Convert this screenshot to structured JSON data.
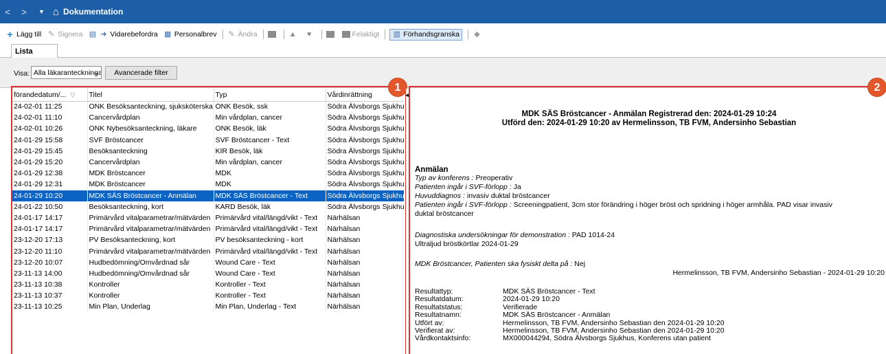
{
  "titlebar": {
    "title": "Dokumentation",
    "back": "<",
    "forward": ">"
  },
  "toolbar": {
    "add": "Lägg till",
    "sign": "Signera",
    "forward": "Vidarebefordra",
    "personal_letter": "Personalbrev",
    "edit": "Ändra",
    "wrong": "Felaktigt",
    "preview": "Förhandsgranska"
  },
  "tabs": {
    "list": "Lista"
  },
  "filter": {
    "show_label": "Visa:",
    "show_value": "Alla läkaranteckningar",
    "advanced_button": "Avancerade filter"
  },
  "list": {
    "columns": [
      "förandedatum/...",
      "Titel",
      "Typ",
      "Vårdinrättning"
    ],
    "rows": [
      [
        "24-02-01 11:25",
        "ONK Besöksanteckning, sjuksköterska",
        "ONK Besök, ssk",
        "Södra Älvsborgs Sjukhus"
      ],
      [
        "24-02-01 11:10",
        "Cancervårdplan",
        "Min vårdplan, cancer",
        "Södra Älvsborgs Sjukhus"
      ],
      [
        "24-02-01 10:26",
        "ONK Nybesöksanteckning, läkare",
        "ONK Besök, läk",
        "Södra Älvsborgs Sjukhus"
      ],
      [
        "24-01-29 15:58",
        "SVF Bröstcancer",
        "SVF Bröstcancer - Text",
        "Södra Älvsborgs Sjukhus"
      ],
      [
        "24-01-29 15:45",
        "Besöksanteckning",
        "KIR Besök, läk",
        "Södra Älvsborgs Sjukhus"
      ],
      [
        "24-01-29 15:20",
        "Cancervårdplan",
        "Min vårdplan, cancer",
        "Södra Älvsborgs Sjukhus"
      ],
      [
        "24-01-29 12:38",
        "MDK Bröstcancer",
        "MDK",
        "Södra Älvsborgs Sjukhus"
      ],
      [
        "24-01-29 12:31",
        "MDK Bröstcancer",
        "MDK",
        "Södra Älvsborgs Sjukhus"
      ],
      [
        "24-01-29 10:20",
        "MDK SÄS Bröstcancer - Anmälan",
        "MDK SÄS Bröstcancer - Text",
        "Södra Älvsborgs Sjukhus"
      ],
      [
        "24-01-22 10:50",
        "Besöksanteckning, kort",
        "KARD Besök, läk",
        "Södra Älvsborgs Sjukhus"
      ],
      [
        "24-01-17 14:17",
        "Primärvård vitalparametrar/mätvärden",
        "Primärvård vital/längd/vikt - Text",
        "Närhälsan"
      ],
      [
        "24-01-17 14:17",
        "Primärvård vitalparametrar/mätvärden",
        "Primärvård vital/längd/vikt - Text",
        "Närhälsan"
      ],
      [
        "23-12-20 17:13",
        "PV Besöksanteckning, kort",
        "PV besöksanteckning - kort",
        "Närhälsan"
      ],
      [
        "23-12-20 11:10",
        "Primärvård vitalparametrar/mätvärden",
        "Primärvård vital/längd/vikt - Text",
        "Närhälsan"
      ],
      [
        "23-12-20 10:07",
        "Hudbedömning/Omvårdnad sår",
        "Wound Care - Text",
        "Närhälsan"
      ],
      [
        "23-11-13 14:00",
        "Hudbedömning/Omvårdnad sår",
        "Wound Care - Text",
        "Närhälsan"
      ],
      [
        "23-11-13 10:38",
        "Kontroller",
        "Kontroller - Text",
        "Närhälsan"
      ],
      [
        "23-11-13 10:37",
        "Kontroller",
        "Kontroller - Text",
        "Närhälsan"
      ],
      [
        "23-11-13 10:25",
        "Min Plan, Underlag",
        "Min Plan, Underlag - Text",
        "Närhälsan"
      ]
    ],
    "selected_index": 8
  },
  "badges": {
    "one": "1",
    "two": "2"
  },
  "document": {
    "header1": "MDK SÄS Bröstcancer - Anmälan Registrerad den:  2024-01-29 10:24",
    "header2": "Utförd den:  2024-01-29 10:20  av Hermelinsson, TB FVM, Andersinho Sebastian",
    "section": "Anmälan",
    "conf_label": "Typ av konferens :",
    "conf_value": " Preoperativ",
    "svf1_label": "Patienten ingår i SVF-förlopp :",
    "svf1_value": " Ja",
    "diag_label": "Huvuddiagnos :",
    "diag_value": " invasiv duktal bröstcancer",
    "svf2_label": "Patienten ingår i SVF-förlopp :",
    "svf2_value": " Screeningpatient, 3cm stor förändring i höger bröst och spridning i höger armhåla. PAD visar invasiv",
    "svf2_cont": "duktal bröstcancer",
    "exam_label": "Diagnostiska undersökningar för demonstration :",
    "exam_value": " PAD 1014-24",
    "ultra": "Ultraljud bröstkörtlar 2024-01-29",
    "mdk_label": "MDK Bröstcancer, Patienten ska fysiskt delta på :",
    "mdk_value": " Nej",
    "signature": "Hermelinsson, TB FVM, Andersinho Sebastian - 2024-01-29 10:20",
    "results": [
      {
        "k": "Resultattyp:",
        "v": "MDK SÄS Bröstcancer - Text"
      },
      {
        "k": "Resultatdatum:",
        "v": "2024-01-29 10:20"
      },
      {
        "k": "Resultatstatus:",
        "v": "Verifierade"
      },
      {
        "k": "Resultatnamn:",
        "v": "MDK SÄS Bröstcancer - Anmälan"
      },
      {
        "k": "Utfört av:",
        "v": "Hermelinsson, TB FVM, Andersinho Sebastian den 2024-01-29 10:20"
      },
      {
        "k": "Verifierat av:",
        "v": "Hermelinsson, TB FVM, Andersinho Sebastian den 2024-01-29 10:20"
      },
      {
        "k": "Vårdkontaktsinfo:",
        "v": "MX000044294, Södra Älvsborgs Sjukhus, Konferens utan patient"
      }
    ]
  },
  "colors": {
    "titlebar": "#1c5fa8",
    "selection": "#0b63c4",
    "highlight_box": "#e0322e",
    "badge": "#e2572c"
  }
}
